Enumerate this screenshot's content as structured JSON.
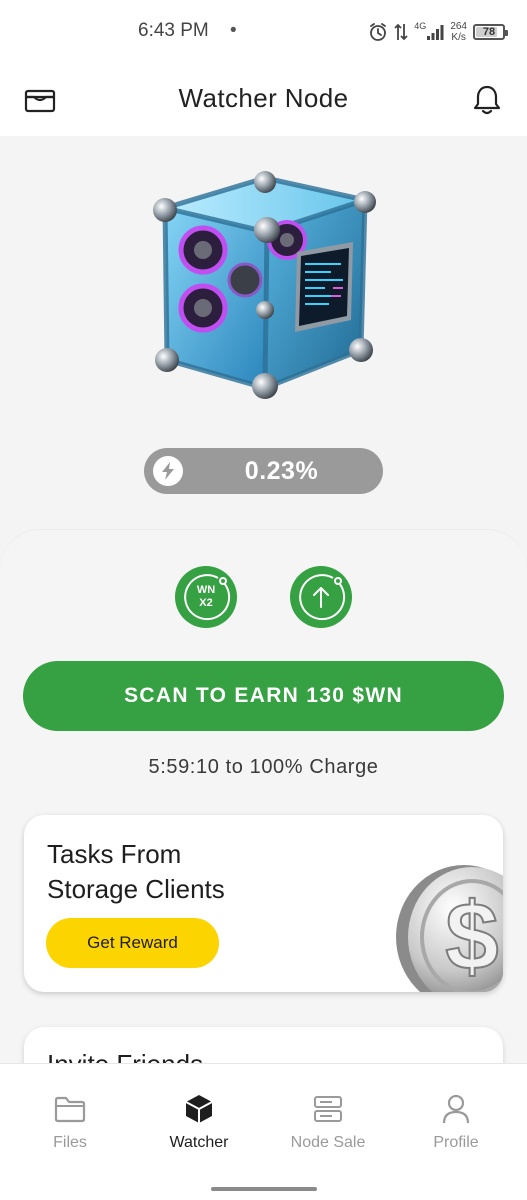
{
  "status_bar": {
    "time": "6:43 PM",
    "separator": "•",
    "network": "4G",
    "speed_value": "264",
    "speed_unit": "K/s",
    "battery": "78"
  },
  "header": {
    "title": "Watcher Node",
    "wallet_icon": "wallet-icon",
    "bell_icon": "bell-icon"
  },
  "hero": {
    "image": "watcher-node-cube",
    "charge_percent": "0.23%",
    "charge_icon": "lightning-icon"
  },
  "actions": {
    "boost_label_line1": "WN",
    "boost_label_line2": "X2",
    "upload_icon": "arrow-up-icon",
    "scan_button": "SCAN TO EARN 130 $WN",
    "charge_timer": "5:59:10 to 100% Charge"
  },
  "tasks_card": {
    "title_line1": "Tasks From",
    "title_line2": "Storage Clients",
    "button": "Get Reward",
    "image": "dollar-coin"
  },
  "invite_card": {
    "title": "Invite Friends"
  },
  "bottom_nav": {
    "items": [
      {
        "label": "Files",
        "icon": "folder-icon",
        "active": false
      },
      {
        "label": "Watcher",
        "icon": "cube-icon",
        "active": true
      },
      {
        "label": "Node Sale",
        "icon": "server-icon",
        "active": false
      },
      {
        "label": "Profile",
        "icon": "user-icon",
        "active": false
      }
    ]
  },
  "colors": {
    "primary_green": "#35a142",
    "reward_yellow": "#fcd400",
    "pill_gray": "#9a9a9a",
    "background": "#f4f4f4"
  }
}
